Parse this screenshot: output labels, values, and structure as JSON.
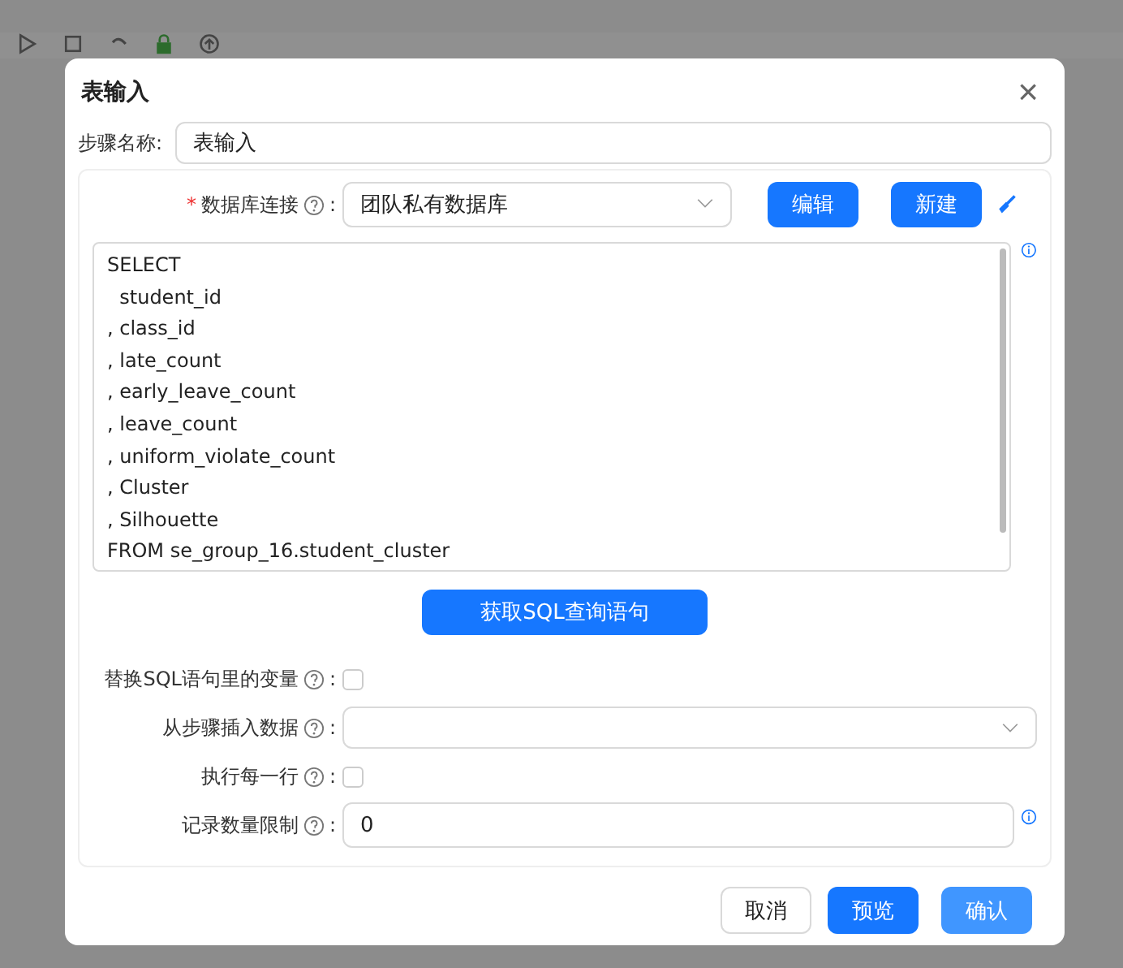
{
  "dialog": {
    "title": "表输入",
    "close": "×"
  },
  "step_name": {
    "label": "步骤名称:",
    "value": "表输入"
  },
  "connection": {
    "required_mark": "*",
    "label": "数据库连接",
    "colon": ":",
    "value": "团队私有数据库",
    "buttons": [
      "编辑",
      "新建"
    ]
  },
  "sql": {
    "lines": [
      "SELECT",
      "  student_id",
      ", class_id",
      ", late_count",
      ", early_leave_count",
      ", leave_count",
      ", uniform_violate_count",
      ", Cluster",
      ", Silhouette",
      "FROM se_group_16.student_cluster"
    ]
  },
  "get_sql_button": "获取SQL查询语句",
  "fields": [
    {
      "kind": "checkbox",
      "label": "替换SQL语句里的变量",
      "checked": false
    },
    {
      "kind": "select",
      "label": "从步骤插入数据"
    },
    {
      "kind": "checkbox",
      "label": "执行每一行",
      "checked": false
    },
    {
      "kind": "input",
      "label": "记录数量限制",
      "value": "0"
    }
  ],
  "footer": [
    {
      "label": "取消",
      "kind": "default"
    },
    {
      "label": "预览",
      "kind": "primary"
    },
    {
      "label": "确认",
      "kind": "light"
    }
  ]
}
